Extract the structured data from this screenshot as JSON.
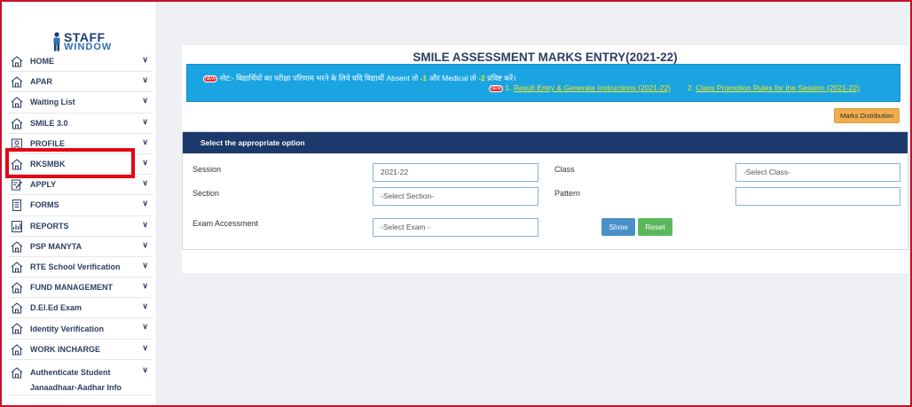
{
  "logo": {
    "line1": "STAFF",
    "line2": "WINDOW"
  },
  "sidebar": {
    "items": [
      {
        "label": "HOME",
        "icon": "home-icon"
      },
      {
        "label": "APAR",
        "icon": "home-icon"
      },
      {
        "label": "Waiting List",
        "icon": "home-icon"
      },
      {
        "label": "SMILE 3.0",
        "icon": "home-icon"
      },
      {
        "label": "PROFILE",
        "icon": "profile-icon"
      },
      {
        "label": "RKSMBK",
        "icon": "home-icon"
      },
      {
        "label": "APPLY",
        "icon": "apply-icon"
      },
      {
        "label": "FORMS",
        "icon": "forms-icon"
      },
      {
        "label": "REPORTS",
        "icon": "reports-icon"
      },
      {
        "label": "PSP MANYTA",
        "icon": "home-icon"
      },
      {
        "label": "RTE School Verification",
        "icon": "home-icon"
      },
      {
        "label": "FUND MANAGEMENT",
        "icon": "home-icon"
      },
      {
        "label": "D.El.Ed Exam",
        "icon": "home-icon"
      },
      {
        "label": "Identity Verification",
        "icon": "home-icon"
      },
      {
        "label": "WORK INCHARGE",
        "icon": "home-icon"
      },
      {
        "label": "Authenticate Student Janaadhaar-Aadhar Info",
        "icon": "home-icon"
      }
    ],
    "chevron": "∨"
  },
  "main": {
    "title": "SMILE ASSESSMENT MARKS ENTRY(2021-22)",
    "notice": {
      "badge": "NEW",
      "line1_prefix": "नोट:- विद्यार्थियों का परीक्षा परिणाम भरने के लिये यदि विद्यार्थी Absent तो ",
      "absent_value": "-1",
      "line1_mid": " और Medical तो ",
      "medical_value": "-2",
      "line1_suffix": " प्रविष्ट करें।",
      "link1_num": "1.",
      "link1": "Result Entry & Generate Instructions (2021-22)",
      "link2_num": "2.",
      "link2": "Class Promotion Rules for the Session (2021-22)"
    },
    "marks_button": "Marks Distribution",
    "panel": {
      "heading": "Select the appropriate option",
      "session_label": "Session",
      "session_value": "2021-22",
      "class_label": "Class",
      "class_value": "-Select Class-",
      "section_label": "Section",
      "section_value": "-Select Section-",
      "pattern_label": "Pattern",
      "pattern_value": "",
      "exam_label": "Exam Accessment",
      "exam_value": "-Select Exam -",
      "show_button": "Show",
      "reset_button": "Reset"
    }
  },
  "colors": {
    "accent": "#1b3a6b",
    "notice_bg": "#1aa5e2",
    "highlight_box": "#e30613",
    "marks_button": "#f0ad4e",
    "show_button": "#4a90c8",
    "reset_button": "#5cb85c"
  }
}
